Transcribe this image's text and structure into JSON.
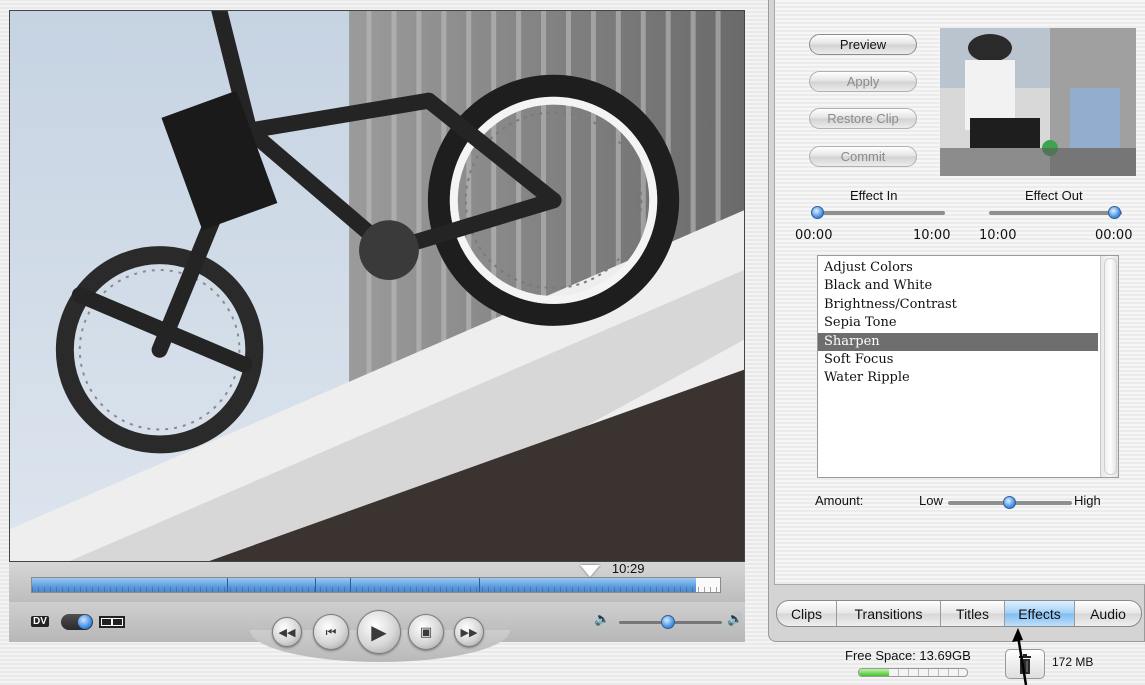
{
  "monitor": {
    "timecode": "10:29",
    "playhead_position": 0.81,
    "scrub_filled_fraction": 0.965,
    "clip_boundaries": [
      0.282,
      0.41,
      0.461,
      0.648
    ],
    "volume_level": 0.48,
    "mode_label": "DV",
    "transport_icons": [
      "rewind-icon",
      "previous-icon",
      "play-icon",
      "fullscreen-play-icon",
      "fast-forward-icon"
    ]
  },
  "effects_panel": {
    "buttons": {
      "preview": "Preview",
      "apply": "Apply",
      "restore": "Restore Clip",
      "commit": "Commit"
    },
    "effect_in": {
      "label": "Effect In",
      "min": "00:00",
      "max": "10:00",
      "value_fraction": 0.05
    },
    "effect_out": {
      "label": "Effect Out",
      "min": "10:00",
      "max": "00:00",
      "value_fraction": 0.95
    },
    "effects": [
      "Adjust Colors",
      "Black and White",
      "Brightness/Contrast",
      "Sepia Tone",
      "Sharpen",
      "Soft Focus",
      "Water Ripple"
    ],
    "selected_effect": "Sharpen",
    "amount": {
      "label": "Amount:",
      "low": "Low",
      "high": "High",
      "value_fraction": 0.5
    }
  },
  "tabs": [
    "Clips",
    "Transitions",
    "Titles",
    "Effects",
    "Audio"
  ],
  "active_tab": "Effects",
  "status": {
    "free_space": "Free Space: 13.69GB",
    "free_space_fraction": 0.28,
    "trash_size": "172 MB"
  },
  "colors": {
    "accent_blue": "#5b9be0",
    "selected_row": "#6e6e6e",
    "meter_green": "#46c22c"
  }
}
